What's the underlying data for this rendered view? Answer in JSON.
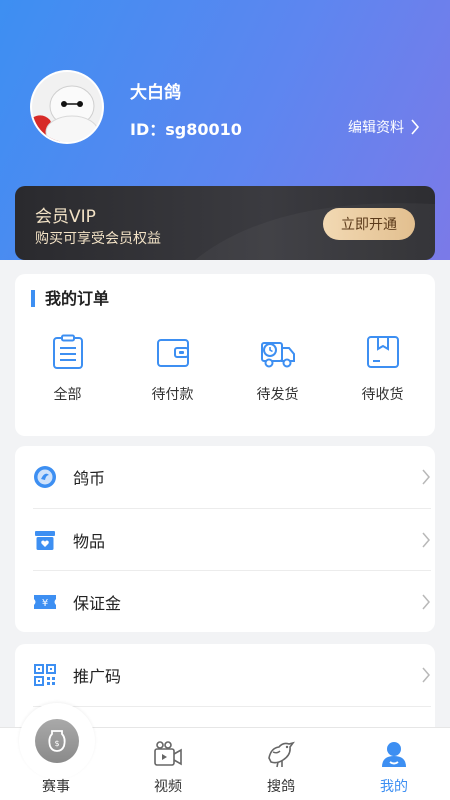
{
  "profile": {
    "name": "大白鸽",
    "id_text": "ID：sg80010",
    "edit_label": "编辑资料"
  },
  "vip": {
    "title": "会员VIP",
    "description": "购买可享受会员权益",
    "button_label": "立即开通"
  },
  "orders": {
    "title": "我的订单",
    "items": [
      {
        "label": "全部",
        "icon": "clipboard-icon"
      },
      {
        "label": "待付款",
        "icon": "wallet-icon"
      },
      {
        "label": "待发货",
        "icon": "truck-icon"
      },
      {
        "label": "待收货",
        "icon": "box-icon"
      }
    ]
  },
  "menu": {
    "items": [
      {
        "label": "鸽币",
        "icon": "coin-icon"
      },
      {
        "label": "物品",
        "icon": "item-box-icon"
      },
      {
        "label": "保证金",
        "icon": "ticket-icon"
      },
      {
        "label": "推广码",
        "icon": "qrcode-icon"
      }
    ]
  },
  "tabs": [
    {
      "label": "赛事",
      "icon": "trophy-icon"
    },
    {
      "label": "视频",
      "icon": "video-icon"
    },
    {
      "label": "搜鸽",
      "icon": "pigeon-icon"
    },
    {
      "label": "我的",
      "icon": "user-icon",
      "active": true
    }
  ],
  "colors": {
    "accent": "#3d8ff2",
    "gradient_start": "#3d8ff2",
    "gradient_end": "#7b7ae8",
    "vip_text": "#f2e2c6"
  }
}
